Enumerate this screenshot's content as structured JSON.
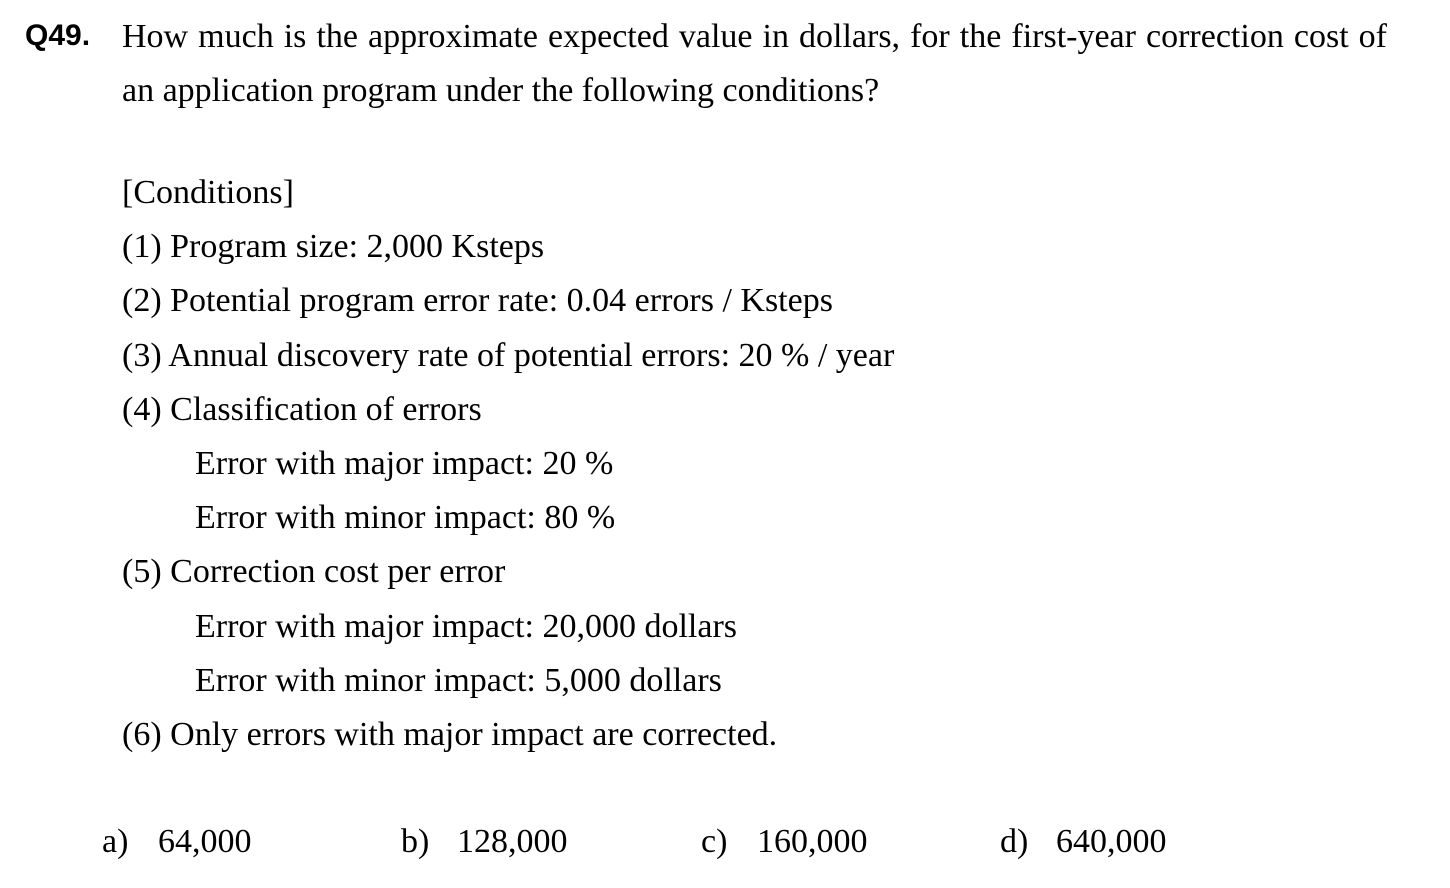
{
  "question": {
    "number": "Q49.",
    "text": "How much is the approximate expected value in dollars, for the first-year correction cost of an application program under the following conditions?"
  },
  "conditions": {
    "heading": "[Conditions]",
    "lines": [
      "(1) Program size: 2,000 Ksteps",
      "(2) Potential program error rate: 0.04 errors / Ksteps",
      "(3) Annual discovery rate of potential errors: 20 % / year",
      "(4) Classification of errors",
      "Error with major impact: 20 %",
      "Error with minor impact: 80 %",
      "(5) Correction cost per error",
      "Error with major impact: 20,000 dollars",
      "Error with minor impact: 5,000 dollars",
      "(6) Only errors with major impact are corrected."
    ]
  },
  "choices": [
    {
      "letter": "a)",
      "value": "64,000"
    },
    {
      "letter": "b)",
      "value": "128,000"
    },
    {
      "letter": "c)",
      "value": "160,000"
    },
    {
      "letter": "d)",
      "value": "640,000"
    }
  ]
}
